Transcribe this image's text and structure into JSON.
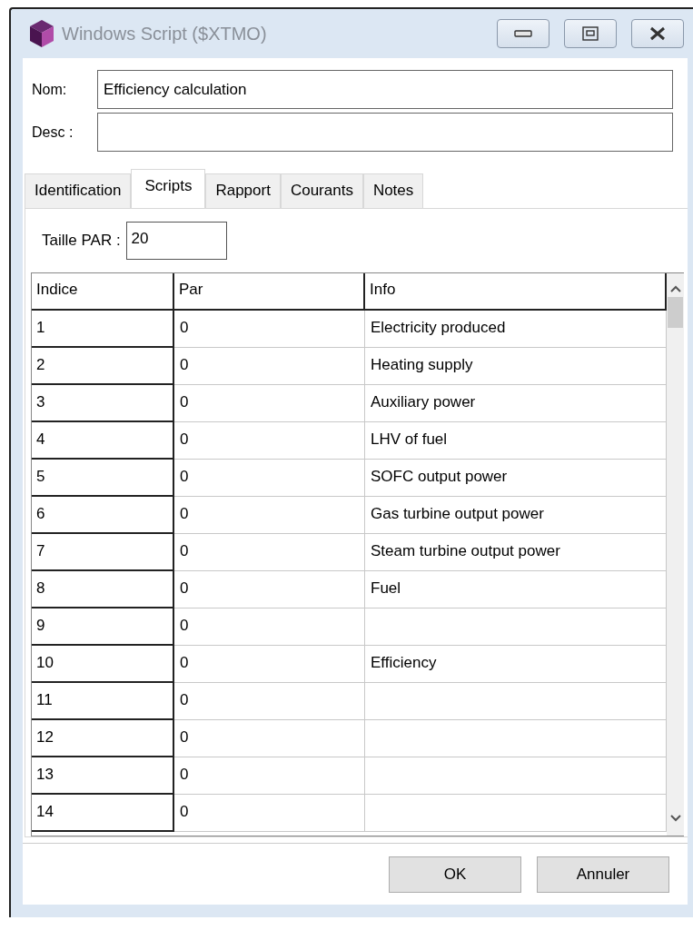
{
  "window": {
    "title": "Windows Script ($XTMO)"
  },
  "fields": [
    {
      "label": "Nom:",
      "value": "Efficiency calculation"
    },
    {
      "label": "Desc :"
    }
  ],
  "tabs": [
    {
      "label": "Identification",
      "selected": false
    },
    {
      "label": "Scripts",
      "selected": true
    },
    {
      "label": "Rapport",
      "selected": false
    },
    {
      "label": "Courants",
      "selected": false
    },
    {
      "label": "Notes",
      "selected": false
    }
  ],
  "size_field": {
    "label": "Taille PAR :",
    "value": "20"
  },
  "table": {
    "columns": [
      "Indice",
      "Par",
      "Info"
    ],
    "rows": [
      {
        "indice": "1",
        "par": "0",
        "info": "Electricity produced"
      },
      {
        "indice": "2",
        "par": "0",
        "info": "Heating supply"
      },
      {
        "indice": "3",
        "par": "0",
        "info": "Auxiliary power"
      },
      {
        "indice": "4",
        "par": "0",
        "info": "LHV of fuel"
      },
      {
        "indice": "5",
        "par": "0",
        "info": "SOFC output power"
      },
      {
        "indice": "6",
        "par": "0",
        "info": "Gas turbine output power"
      },
      {
        "indice": "7",
        "par": "0",
        "info": "Steam turbine output power"
      },
      {
        "indice": "8",
        "par": "0",
        "info": "Fuel"
      },
      {
        "indice": "9",
        "par": "0"
      },
      {
        "indice": "10",
        "par": "0",
        "info": "Efficiency"
      },
      {
        "indice": "11",
        "par": "0"
      },
      {
        "indice": "12",
        "par": "0"
      },
      {
        "indice": "13",
        "par": "0"
      },
      {
        "indice": "14",
        "par": "0"
      }
    ]
  },
  "buttons": [
    "OK",
    "Annuler"
  ]
}
